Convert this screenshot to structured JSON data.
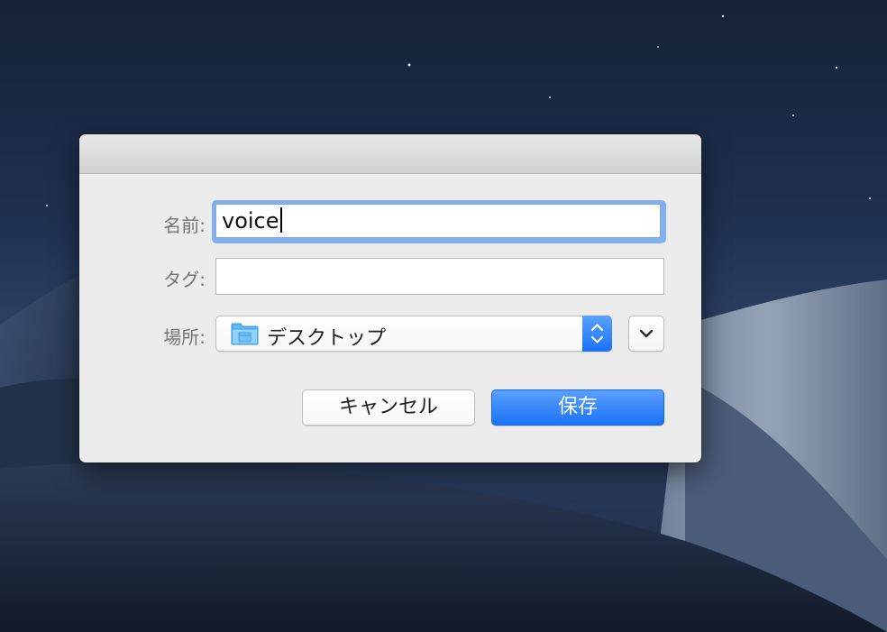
{
  "dialog": {
    "name_label": "名前:",
    "tag_label": "タグ:",
    "location_label": "場所:",
    "name_value": "voice",
    "tag_value": "",
    "location_value": "デスクトップ",
    "cancel_label": "キャンセル",
    "save_label": "保存"
  },
  "icons": {
    "folder": "folder-icon",
    "stepper": "up-down-chevron-icon",
    "expand": "chevron-down-icon"
  },
  "colors": {
    "accent": "#1b73f6",
    "focus_ring": "#7fb0ef",
    "folder": "#5eb8f2"
  }
}
